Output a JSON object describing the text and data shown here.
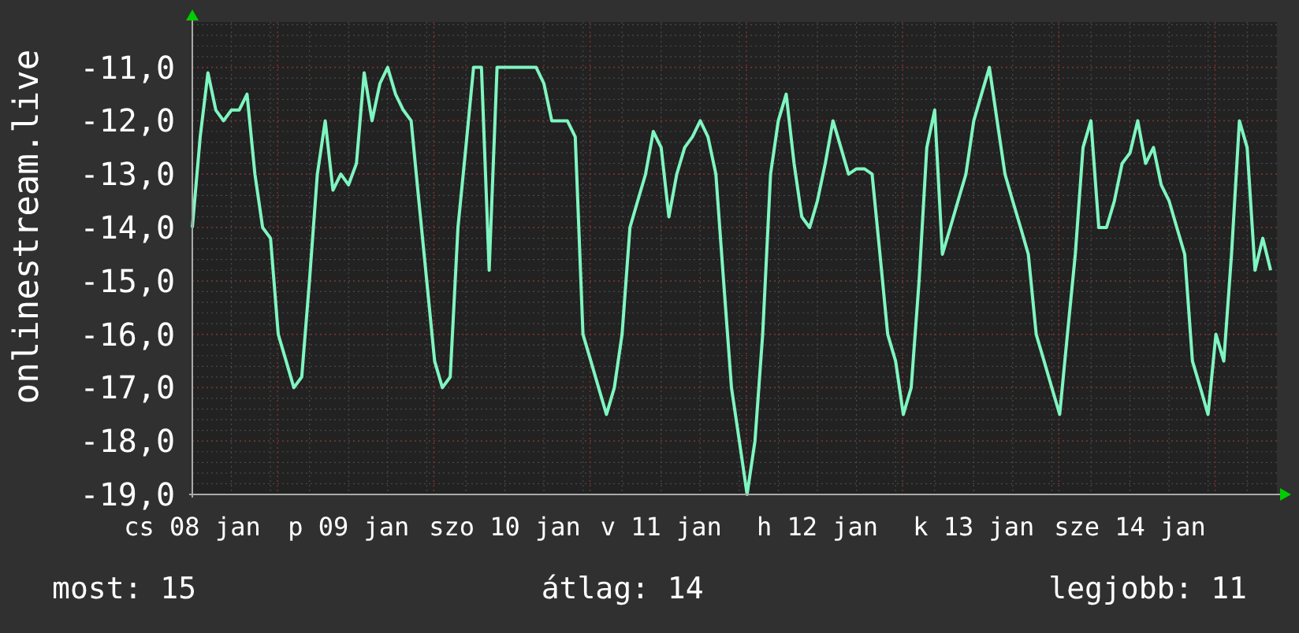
{
  "chart_data": {
    "type": "line",
    "ylabel": "onlinestream.live",
    "grid": true,
    "ylim": [
      -19,
      -10.15
    ],
    "categories": [
      "cs 08 jan",
      null,
      null,
      null,
      null,
      null,
      null,
      null,
      null,
      null,
      null,
      null,
      null,
      null,
      null,
      null,
      null,
      null,
      null,
      null,
      "p 09 jan",
      null,
      null,
      null,
      null,
      null,
      null,
      null,
      null,
      null,
      null,
      null,
      null,
      null,
      null,
      null,
      null,
      null,
      null,
      null,
      "szo 10 jan",
      null,
      null,
      null,
      null,
      null,
      null,
      null,
      null,
      null,
      null,
      null,
      null,
      null,
      null,
      null,
      null,
      null,
      null,
      null,
      "v 11 jan",
      null,
      null,
      null,
      null,
      null,
      null,
      null,
      null,
      null,
      null,
      null,
      null,
      null,
      null,
      null,
      null,
      null,
      null,
      null,
      "h 12 jan",
      null,
      null,
      null,
      null,
      null,
      null,
      null,
      null,
      null,
      null,
      null,
      null,
      null,
      null,
      null,
      null,
      null,
      null,
      null,
      "k 13 jan",
      null,
      null,
      null,
      null,
      null,
      null,
      null,
      null,
      null,
      null,
      null,
      null,
      null,
      null,
      null,
      null,
      null,
      null,
      null,
      "sze 14 jan",
      null,
      null,
      null,
      null,
      null,
      null,
      null,
      null,
      null,
      null,
      null,
      null,
      null,
      null,
      null,
      null,
      null,
      null
    ],
    "yticks": [
      {
        "value": -11,
        "label": "-11,0"
      },
      {
        "value": -12,
        "label": "-12,0"
      },
      {
        "value": -13,
        "label": "-13,0"
      },
      {
        "value": -14,
        "label": "-14,0"
      },
      {
        "value": -15,
        "label": "-15,0"
      },
      {
        "value": -16,
        "label": "-16,0"
      },
      {
        "value": -17,
        "label": "-17,0"
      },
      {
        "value": -18,
        "label": "-18,0"
      },
      {
        "value": -19,
        "label": "-19,0"
      }
    ],
    "series": [
      {
        "color": "#7ff5c0",
        "values": [
          -14,
          -12.3,
          -11.1,
          -11.8,
          -12,
          -11.8,
          -11.8,
          -11.5,
          -13,
          -14,
          -14.2,
          -16,
          -16.5,
          -17,
          -16.8,
          -15,
          -13,
          -12,
          -13.3,
          -13,
          -13.2,
          -12.8,
          -11.1,
          -12,
          -11.3,
          -11,
          -11.5,
          -11.8,
          -12,
          -13.5,
          -15,
          -16.5,
          -17,
          -16.8,
          -14,
          -12.5,
          -11,
          -11,
          -14.8,
          -11,
          -11,
          -11,
          -11,
          -11,
          -11,
          -11.3,
          -12,
          -12,
          -12,
          -12.3,
          -16,
          -16.5,
          -17,
          -17.5,
          -17,
          -16,
          -14,
          -13.5,
          -13,
          -12.2,
          -12.5,
          -13.8,
          -13,
          -12.5,
          -12.3,
          -12,
          -12.3,
          -13,
          -15,
          -17,
          -18,
          -19,
          -18,
          -16,
          -13,
          -12,
          -11.5,
          -12.8,
          -13.8,
          -14,
          -13.5,
          -12.8,
          -12,
          -12.5,
          -13,
          -12.9,
          -12.9,
          -13,
          -14.5,
          -16,
          -16.5,
          -17.5,
          -17,
          -15,
          -12.5,
          -11.8,
          -14.5,
          -14,
          -13.5,
          -13,
          -12,
          -11.5,
          -11,
          -12,
          -13,
          -13.5,
          -14,
          -14.5,
          -16,
          -16.5,
          -17,
          -17.5,
          -16,
          -14.5,
          -12.5,
          -12,
          -14,
          -14,
          -13.5,
          -12.8,
          -12.6,
          -12,
          -12.8,
          -12.5,
          -13.2,
          -13.5,
          -14,
          -14.5,
          -16.5,
          -17,
          -17.5,
          -16,
          -16.5,
          -14.5,
          -12,
          -12.5,
          -14.8,
          -14.2,
          -14.8
        ]
      }
    ]
  },
  "legend": [
    "most: 15",
    "átlag: 14",
    "legjobb: 11"
  ]
}
